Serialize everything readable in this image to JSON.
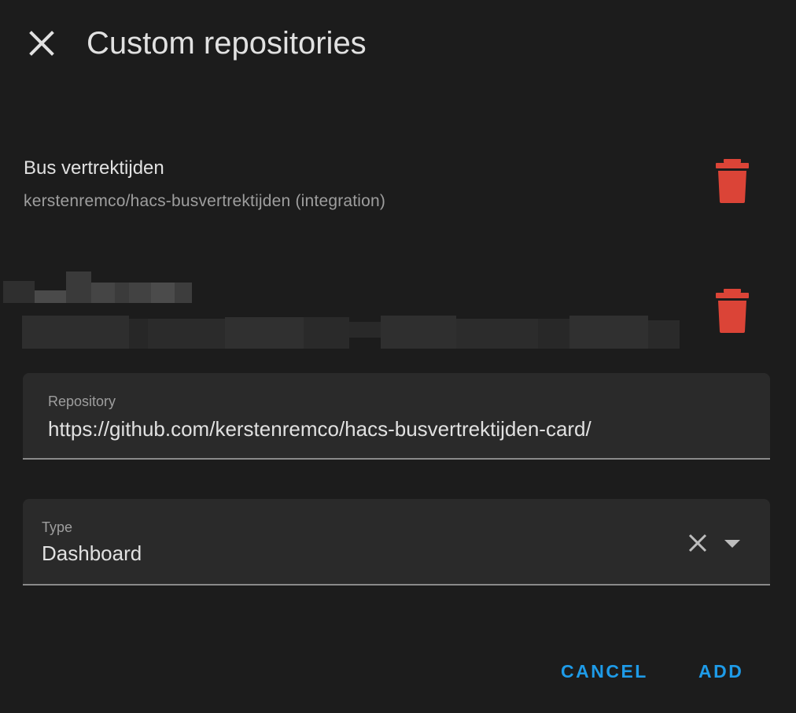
{
  "dialog": {
    "title": "Custom repositories",
    "close_icon": "close-icon"
  },
  "repositories": [
    {
      "name": "Bus vertrektijden",
      "subtitle": "kerstenremco/hacs-busvertrektijden (integration)",
      "delete_icon": "trash-icon"
    },
    {
      "name": "",
      "subtitle": "",
      "delete_icon": "trash-icon"
    }
  ],
  "repository_field": {
    "label": "Repository",
    "value": "https://github.com/kerstenremco/hacs-busvertrektijden-card/"
  },
  "type_field": {
    "label": "Type",
    "value": "Dashboard",
    "clear_icon": "close-icon",
    "dropdown_icon": "caret-down-icon"
  },
  "actions": {
    "cancel_label": "CANCEL",
    "add_label": "ADD"
  },
  "colors": {
    "background": "#1c1c1c",
    "field_background": "#2a2a2a",
    "delete": "#db4437",
    "accent": "#1e9be8"
  }
}
